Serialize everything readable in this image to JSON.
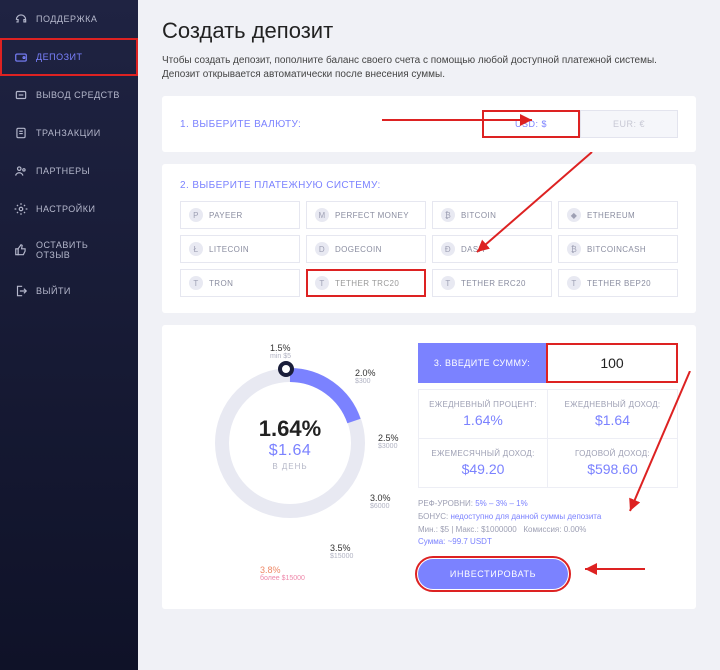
{
  "sidebar": [
    {
      "icon": "headset",
      "label": "ПОДДЕРЖКА"
    },
    {
      "icon": "wallet",
      "label": "ДЕПОЗИТ",
      "active": true
    },
    {
      "icon": "cashout",
      "label": "ВЫВОД СРЕДСТВ"
    },
    {
      "icon": "tx",
      "label": "ТРАНЗАКЦИИ"
    },
    {
      "icon": "partners",
      "label": "ПАРТНЕРЫ"
    },
    {
      "icon": "gear",
      "label": "НАСТРОЙКИ"
    },
    {
      "icon": "thumb",
      "label": "ОСТАВИТЬ ОТЗЫВ"
    },
    {
      "icon": "exit",
      "label": "ВЫЙТИ"
    }
  ],
  "page": {
    "title": "Создать депозит",
    "intro": "Чтобы создать депозит, пополните баланс своего счета с помощью любой доступной платежной системы. Депозит открывается автоматически после внесения суммы."
  },
  "step1": {
    "label": "1. ВЫБЕРИТЕ ВАЛЮТУ:",
    "options": [
      {
        "label": "USD: $",
        "selected": true
      },
      {
        "label": "EUR: €",
        "disabled": true
      }
    ]
  },
  "step2": {
    "label": "2. ВЫБЕРИТЕ ПЛАТЕЖНУЮ СИСТЕМУ:",
    "options": [
      {
        "i": "P",
        "label": "PAYEER"
      },
      {
        "i": "M",
        "label": "PERFECT MONEY"
      },
      {
        "i": "₿",
        "label": "BITCOIN"
      },
      {
        "i": "◆",
        "label": "ETHEREUM"
      },
      {
        "i": "Ł",
        "label": "LITECOIN"
      },
      {
        "i": "D",
        "label": "DOGECOIN"
      },
      {
        "i": "Ð",
        "label": "DASH"
      },
      {
        "i": "₿",
        "label": "BITCOINCASH"
      },
      {
        "i": "T",
        "label": "TRON"
      },
      {
        "i": "T",
        "label": "TETHER TRC20",
        "selected": true
      },
      {
        "i": "T",
        "label": "TETHER ERC20"
      },
      {
        "i": "T",
        "label": "TETHER BEP20"
      }
    ]
  },
  "step3": {
    "label": "3. ВВЕДИТЕ СУММУ:",
    "amount": "100"
  },
  "dial": {
    "rate": "1.64%",
    "amount": "$1.64",
    "per": "В ДЕНЬ",
    "ticks": [
      {
        "pct": "1.5%",
        "sub": "min $5"
      },
      {
        "pct": "2.0%",
        "sub": "$300"
      },
      {
        "pct": "2.5%",
        "sub": "$3000"
      },
      {
        "pct": "3.0%",
        "sub": "$6000"
      },
      {
        "pct": "3.5%",
        "sub": "$15000"
      },
      {
        "pct": "3.8%",
        "sub": "более $15000"
      }
    ]
  },
  "stats": [
    {
      "label": "ЕЖЕДНЕВНЫЙ ПРОЦЕНТ:",
      "value": "1.64%"
    },
    {
      "label": "ЕЖЕДНЕВНЫЙ ДОХОД:",
      "value": "$1.64"
    },
    {
      "label": "ЕЖЕМЕСЯЧНЫЙ ДОХОД:",
      "value": "$49.20"
    },
    {
      "label": "ГОДОВОЙ ДОХОД:",
      "value": "$598.60"
    }
  ],
  "meta": {
    "ref_label": "РЕФ-УРОВНИ:",
    "ref_value": "5% – 3% – 1%",
    "bonus_label": "БОНУС:",
    "bonus_value": "недоступно для данной суммы депозита",
    "line3a": "Мин.: $5 | Макс.: $1000000",
    "line3b": "Комиссия: 0.00%",
    "line4": "Сумма: ~99.7 USDT"
  },
  "invest_label": "ИНВЕСТИРОВАТЬ"
}
